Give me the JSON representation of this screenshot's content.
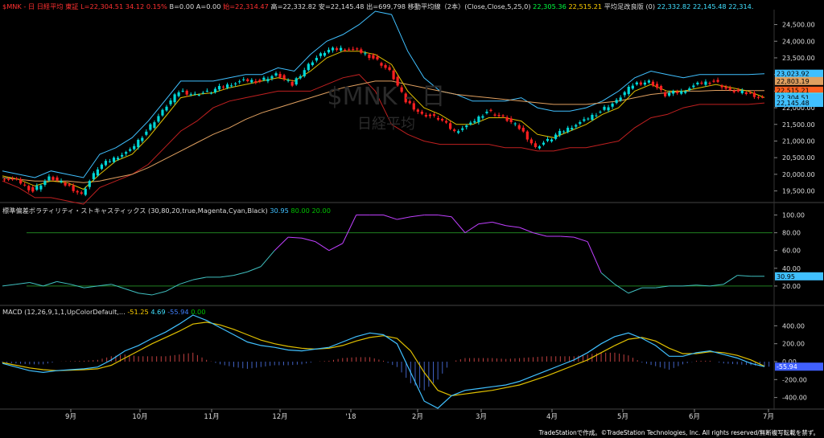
{
  "header": {
    "symbol": "$MNK - 日 日経平均 東証",
    "symbol_color": "#ff3030",
    "last_label": "L=22,304.51",
    "change": "34.12",
    "change_pct": "0.15%",
    "bid": "B=0.00",
    "ask": "A=0.00",
    "open": "始=22,314.47",
    "high": "高=22,332.82",
    "low": "安=22,145.48",
    "volume": "出=699,798",
    "ma_label": "移動平均線（2本）(Close,Close,5,25,0)",
    "ma1": "22,305.36",
    "ma2": "22,515.21",
    "ichimoku_label": "平均足改良版 (0)",
    "hl1": "22,332.82",
    "hl2": "22,145.48",
    "hl3": "22,314."
  },
  "watermark": {
    "line1": "$MNK - 日",
    "line2": "日経平均"
  },
  "stoch": {
    "label": "標準偏差ボラティリティ・ストキャスティックス (30,80,20,true,Magenta,Cyan,Black)",
    "v1": "30.95",
    "v2": "80.00",
    "v3": "20.00"
  },
  "macd": {
    "label": "MACD (12,26,9,1,1,UpColorDefault,...",
    "v1": "-51.25",
    "v2": "4.69",
    "v3": "-55.94",
    "v4": "0.00"
  },
  "price_axis_ticks": [
    "24,500.00",
    "24,000.00",
    "23,500.00",
    "23,000.00",
    "22,500.00",
    "22,000.00",
    "21,500.00",
    "21,000.00",
    "20,500.00",
    "20,000.00",
    "19,500.00"
  ],
  "price_badges": [
    "23,023.92",
    "22,803.19",
    "22,515.21",
    "22,332.82",
    "22,304.51",
    "22,145.48"
  ],
  "stoch_axis_ticks": [
    "100.00",
    "80.00",
    "60.00",
    "40.00",
    "20.00"
  ],
  "stoch_badge": "30.95",
  "macd_axis_ticks": [
    "400.00",
    "200.00",
    "0.00",
    "-200.00",
    "-400.00"
  ],
  "macd_badge": "-55.94",
  "x_axis_labels": [
    "9月",
    "10月",
    "11月",
    "12月",
    "'18",
    "2月",
    "3月",
    "4月",
    "5月",
    "6月",
    "7月"
  ],
  "footer": "TradeStationで作成。©TradeStation Technologies, Inc. All rights reserved/無断複写転載を禁ず。",
  "colors": {
    "up": "#00d8d8",
    "down": "#ff2020",
    "bb_band": "#40c0ff",
    "ma_short": "#e0c000",
    "ma_long": "#e0a060",
    "stoch_hi": "#c040ff",
    "stoch_lo": "#40c0c0",
    "macd_line": "#40c0ff",
    "signal_line": "#e0c000",
    "hist_up": "#c04040",
    "hist_down": "#4060c0"
  },
  "chart_data": [
    {
      "type": "candlestick",
      "title": "$MNK - 日 日経平均 東証",
      "x": [
        "9月",
        "10月",
        "11月",
        "12月",
        "'18",
        "2月",
        "3月",
        "4月",
        "5月",
        "6月",
        "7月"
      ],
      "ylim": [
        19200,
        24900
      ],
      "series": [
        {
          "name": "Close",
          "values": [
            19900,
            19800,
            19500,
            19900,
            19700,
            19400,
            20200,
            20500,
            20700,
            21300,
            21900,
            22500,
            22400,
            22500,
            22700,
            22800,
            22800,
            23000,
            22700,
            23300,
            23700,
            23800,
            23700,
            23500,
            23100,
            22200,
            21800,
            21700,
            21300,
            21500,
            21900,
            21700,
            21400,
            20800,
            21100,
            21400,
            21600,
            21900,
            22200,
            22700,
            22800,
            22400,
            22500,
            22700,
            22800,
            22500,
            22450,
            22304
          ]
        },
        {
          "name": "BB upper",
          "values": [
            20100,
            20000,
            19900,
            20100,
            20000,
            19900,
            20600,
            20800,
            21100,
            21600,
            22200,
            22800,
            22800,
            22800,
            22900,
            23000,
            23000,
            23200,
            23100,
            23600,
            24000,
            24200,
            24500,
            24900,
            24800,
            23700,
            22900,
            22500,
            22400,
            22200,
            22200,
            22200,
            22300,
            22000,
            21900,
            21900,
            22000,
            22200,
            22500,
            22900,
            23100,
            23000,
            22900,
            23000,
            23000,
            23000,
            23000,
            23024
          ]
        },
        {
          "name": "BB lower",
          "values": [
            19800,
            19600,
            19300,
            19300,
            19200,
            19100,
            19600,
            19800,
            20000,
            20300,
            20800,
            21300,
            21600,
            22000,
            22200,
            22300,
            22400,
            22500,
            22500,
            22500,
            22700,
            22900,
            23000,
            22500,
            21500,
            21200,
            21000,
            20900,
            20900,
            20900,
            20900,
            20800,
            20800,
            20700,
            20700,
            20800,
            20800,
            20900,
            21000,
            21400,
            21700,
            21800,
            22000,
            22100,
            22100,
            22100,
            22100,
            22145
          ]
        },
        {
          "name": "MA short",
          "values": [
            19950,
            19850,
            19650,
            19800,
            19750,
            19550,
            20000,
            20400,
            20600,
            21100,
            21700,
            22300,
            22400,
            22450,
            22600,
            22700,
            22800,
            22900,
            22800,
            23100,
            23500,
            23700,
            23700,
            23600,
            23300,
            22500,
            22000,
            21800,
            21500,
            21500,
            21700,
            21700,
            21600,
            21200,
            21100,
            21300,
            21500,
            21800,
            22000,
            22500,
            22700,
            22500,
            22500,
            22600,
            22700,
            22600,
            22500,
            22305
          ]
        },
        {
          "name": "MA long",
          "values": [
            19900,
            19850,
            19800,
            19800,
            19800,
            19750,
            19800,
            19900,
            20000,
            20200,
            20450,
            20700,
            20950,
            21200,
            21400,
            21650,
            21850,
            22000,
            22150,
            22300,
            22450,
            22600,
            22700,
            22800,
            22800,
            22700,
            22600,
            22500,
            22400,
            22350,
            22300,
            22250,
            22200,
            22150,
            22100,
            22100,
            22100,
            22150,
            22200,
            22300,
            22400,
            22450,
            22500,
            22500,
            22520,
            22520,
            22515,
            22515
          ]
        }
      ]
    },
    {
      "type": "line",
      "title": "標準偏差ボラティリティ・ストキャスティックス (30,80,20,true,Magenta,Cyan,Black)",
      "ylim": [
        0,
        105
      ],
      "levels": [
        80,
        20
      ],
      "series": [
        {
          "name": "Stoch",
          "values": [
            20,
            22,
            24,
            20,
            25,
            22,
            18,
            20,
            22,
            17,
            12,
            10,
            14,
            22,
            27,
            30,
            30,
            32,
            36,
            42,
            60,
            75,
            74,
            70,
            60,
            68,
            100,
            100,
            100,
            95,
            98,
            100,
            100,
            98,
            80,
            90,
            92,
            88,
            86,
            80,
            76,
            76,
            75,
            70,
            35,
            22,
            12,
            18,
            18,
            20,
            20,
            21,
            20,
            22,
            32,
            31,
            30.95
          ]
        }
      ]
    },
    {
      "type": "line",
      "title": "MACD (12,26,9,1,1,UpColorDefault,...",
      "ylim": [
        -520,
        520
      ],
      "series": [
        {
          "name": "MACD",
          "values": [
            -20,
            -60,
            -100,
            -120,
            -100,
            -90,
            -80,
            -60,
            20,
            120,
            180,
            260,
            330,
            420,
            520,
            460,
            380,
            300,
            220,
            180,
            160,
            130,
            120,
            140,
            160,
            220,
            280,
            320,
            300,
            200,
            -120,
            -440,
            -520,
            -380,
            -320,
            -300,
            -280,
            -260,
            -220,
            -160,
            -100,
            -40,
            20,
            100,
            200,
            280,
            320,
            260,
            180,
            60,
            60,
            100,
            120,
            80,
            40,
            -20,
            -56
          ]
        },
        {
          "name": "Signal",
          "values": [
            -10,
            -40,
            -70,
            -90,
            -100,
            -95,
            -90,
            -80,
            -40,
            40,
            120,
            200,
            270,
            340,
            420,
            440,
            410,
            360,
            300,
            240,
            200,
            170,
            150,
            140,
            150,
            180,
            230,
            270,
            290,
            260,
            120,
            -120,
            -320,
            -380,
            -360,
            -340,
            -320,
            -290,
            -260,
            -210,
            -160,
            -100,
            -40,
            20,
            100,
            180,
            250,
            270,
            230,
            150,
            90,
            90,
            110,
            100,
            70,
            20,
            -51
          ]
        },
        {
          "name": "Histogram",
          "values": [
            -10,
            -20,
            -30,
            -30,
            0,
            5,
            10,
            20,
            60,
            80,
            60,
            60,
            60,
            80,
            100,
            20,
            -30,
            -60,
            -80,
            -60,
            -40,
            -40,
            -30,
            0,
            10,
            40,
            50,
            50,
            10,
            -60,
            -240,
            -320,
            -200,
            0,
            40,
            40,
            40,
            30,
            40,
            50,
            60,
            60,
            60,
            80,
            100,
            100,
            70,
            -10,
            -50,
            -90,
            -30,
            10,
            10,
            -20,
            -30,
            -40,
            -56
          ]
        }
      ]
    }
  ]
}
